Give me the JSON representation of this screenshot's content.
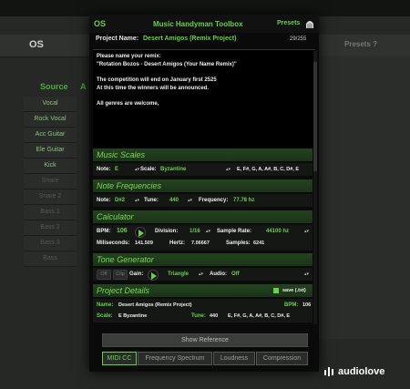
{
  "background": {
    "logo": "OS",
    "presets": "Presets ?",
    "source": "Source",
    "source_a": "A",
    "list": [
      "Vocal",
      "Rock Vocal",
      "Acc Guitar",
      "Ele Guitar",
      "Kick",
      "Snare",
      "Snare 2",
      "Bass 1",
      "Bass 2",
      "Bass 3",
      "Bass"
    ]
  },
  "window": {
    "logo": "OS",
    "title": "Music Handyman Toolbox",
    "presets": "Presets",
    "project_label": "Project Name:",
    "project_name": "Desert Amigos (Remix Project)",
    "char_count": "29/255",
    "notes": [
      "Please name your remix:",
      "\"Rotation Bozos - Desert Amigos (Your Name Remix)\"",
      "",
      "The competition will end on January first 2525",
      "At this time the winners will be announced.",
      "",
      "All genres are welcome,"
    ]
  },
  "music_scales": {
    "title": "Music Scales",
    "note_label": "Note:",
    "note": "E",
    "scale_label": "Scale:",
    "scale": "Byzantine",
    "notes_out": "E, F#, G, A, A#, B, C, D#, E"
  },
  "note_frequencies": {
    "title": "Note Frequencies",
    "note_label": "Note:",
    "note": "D#2",
    "tune_label": "Tune:",
    "tune": "440",
    "frequency_label": "Frequency:",
    "frequency": "77.78 hz"
  },
  "calculator": {
    "title": "Calculator",
    "bpm_label": "BPM:",
    "bpm": "106",
    "division_label": "Division:",
    "division": "1/16",
    "sample_rate_label": "Sample Rate:",
    "sample_rate": "44100 hz",
    "ms_label": "Miliseconds:",
    "ms": "141.509",
    "hertz_label": "Hertz:",
    "hertz": "7.06667",
    "samples_label": "Samples:",
    "samples": "6241"
  },
  "tone_generator": {
    "title": "Tone Generator",
    "off": "Off",
    "clip": "Clip",
    "gain_label": "Gain:",
    "wave": "Triangle",
    "audio_label": "Audio:",
    "audio": "Off"
  },
  "project_details": {
    "title": "Project Details",
    "save_label": "save (.txt)",
    "name_label": "Name:",
    "name": "Desert Amigos (Remix Project)",
    "bpm_label": "BPM:",
    "bpm": "106",
    "scale_label": "Scale:",
    "scale": "E Byzantine",
    "tune_label": "Tune:",
    "tune": "440",
    "notes_out": "E, F#, G, A, A#, B, C, D#, E"
  },
  "bottom": {
    "show_reference": "Show Reference",
    "tabs": [
      "MIDI CC",
      "Frequency Spectrum",
      "Loudness",
      "Compression"
    ]
  },
  "watermark": "audiolove",
  "colors": {
    "accent": "#6bd048",
    "section": "#24431f",
    "window": "#0a0a0a"
  }
}
